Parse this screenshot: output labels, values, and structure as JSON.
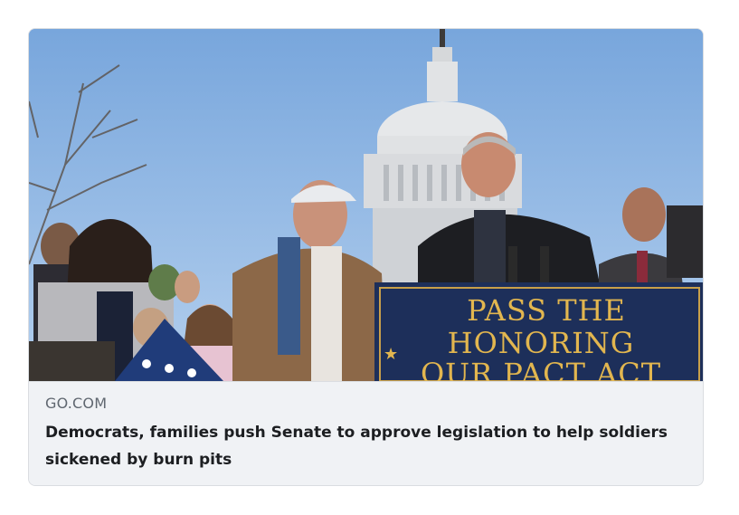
{
  "card": {
    "source": "GO.COM",
    "headline": "Democrats, families push Senate to approve legislation to help soldiers sickened by burn pits"
  },
  "photo": {
    "sign_lines": [
      "PASS THE",
      "HONORING",
      "OUR PACT ACT"
    ]
  },
  "colors": {
    "sky": "#8fb5e0",
    "sign_bg": "#1d2f5a",
    "sign_text": "#e2b64f",
    "meta_bg": "#f0f2f5"
  }
}
